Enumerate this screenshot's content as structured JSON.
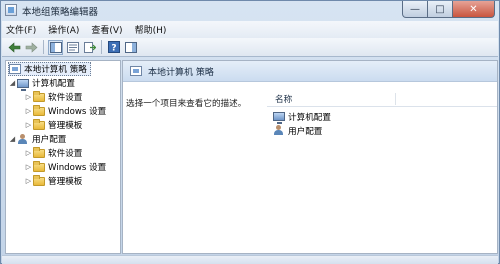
{
  "window": {
    "title": "本地组策略编辑器",
    "minimize": "—",
    "maximize": "□",
    "close": "✕"
  },
  "menu": {
    "file": "文件(F)",
    "action": "操作(A)",
    "view": "查看(V)",
    "help": "帮助(H)"
  },
  "toolbar": {
    "icons": [
      "back-arrow-icon",
      "forward-arrow-icon",
      "show-hide-tree-icon",
      "properties-icon",
      "export-list-icon",
      "help-icon",
      "toggle-pane-icon"
    ]
  },
  "tree": {
    "root": "本地计算机 策略",
    "computer_config": "计算机配置",
    "computer_children": [
      "软件设置",
      "Windows 设置",
      "管理模板"
    ],
    "user_config": "用户配置",
    "user_children": [
      "软件设置",
      "Windows 设置",
      "管理模板"
    ]
  },
  "right": {
    "header_title": "本地计算机 策略",
    "description": "选择一个项目来查看它的描述。",
    "column_name": "名称",
    "items": [
      "计算机配置",
      "用户配置"
    ]
  }
}
